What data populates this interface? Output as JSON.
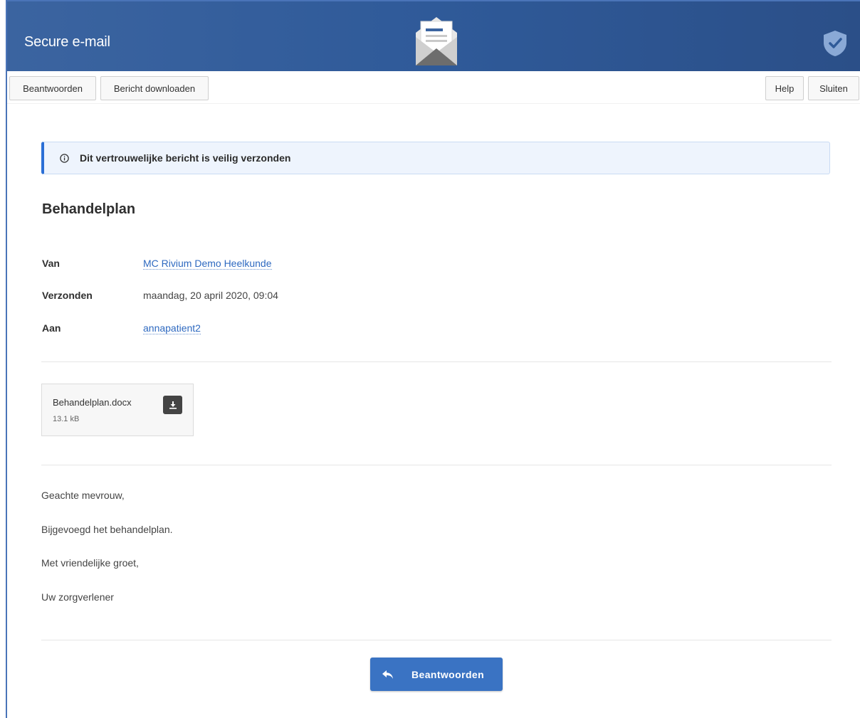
{
  "app": {
    "title": "Secure e-mail"
  },
  "toolbar": {
    "reply_label": "Beantwoorden",
    "download_label": "Bericht downloaden",
    "help_label": "Help",
    "close_label": "Sluiten"
  },
  "notice": {
    "text": "Dit vertrouwelijke bericht is veilig verzonden",
    "icon": "info-icon"
  },
  "message": {
    "subject": "Behandelplan",
    "from_label": "Van",
    "from_value": "MC Rivium Demo Heelkunde",
    "sent_label": "Verzonden",
    "sent_value": "maandag, 20 april 2020, 09:04",
    "to_label": "Aan",
    "to_value": "annapatient2"
  },
  "attachment": {
    "name": "Behandelplan.docx",
    "size": "13.1 kB",
    "icon": "download-icon"
  },
  "body": {
    "greeting": "Geachte mevrouw,",
    "line1": "Bijgevoegd het behandelplan.",
    "closing": "Met vriendelijke groet,",
    "signature": "Uw zorgverlener"
  },
  "reply_button": {
    "label": "Beantwoorden",
    "icon": "reply-icon"
  },
  "colors": {
    "header": "#2f5a99",
    "accent": "#3a73c3",
    "link": "#2e69c0",
    "notice_border": "#2b6fd6"
  }
}
